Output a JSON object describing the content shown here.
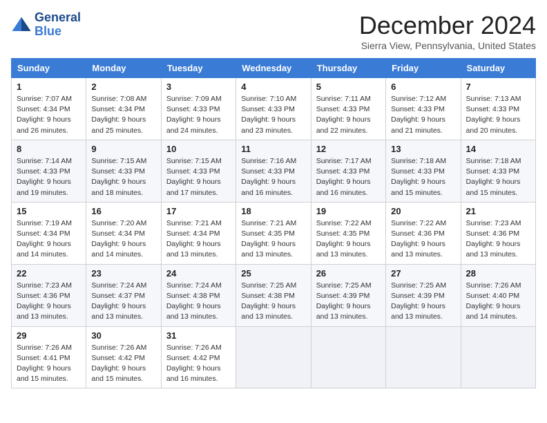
{
  "header": {
    "logo_line1": "General",
    "logo_line2": "Blue",
    "month_title": "December 2024",
    "location": "Sierra View, Pennsylvania, United States"
  },
  "days_of_week": [
    "Sunday",
    "Monday",
    "Tuesday",
    "Wednesday",
    "Thursday",
    "Friday",
    "Saturday"
  ],
  "weeks": [
    [
      {
        "day": "1",
        "sunrise": "Sunrise: 7:07 AM",
        "sunset": "Sunset: 4:34 PM",
        "daylight": "Daylight: 9 hours and 26 minutes."
      },
      {
        "day": "2",
        "sunrise": "Sunrise: 7:08 AM",
        "sunset": "Sunset: 4:34 PM",
        "daylight": "Daylight: 9 hours and 25 minutes."
      },
      {
        "day": "3",
        "sunrise": "Sunrise: 7:09 AM",
        "sunset": "Sunset: 4:33 PM",
        "daylight": "Daylight: 9 hours and 24 minutes."
      },
      {
        "day": "4",
        "sunrise": "Sunrise: 7:10 AM",
        "sunset": "Sunset: 4:33 PM",
        "daylight": "Daylight: 9 hours and 23 minutes."
      },
      {
        "day": "5",
        "sunrise": "Sunrise: 7:11 AM",
        "sunset": "Sunset: 4:33 PM",
        "daylight": "Daylight: 9 hours and 22 minutes."
      },
      {
        "day": "6",
        "sunrise": "Sunrise: 7:12 AM",
        "sunset": "Sunset: 4:33 PM",
        "daylight": "Daylight: 9 hours and 21 minutes."
      },
      {
        "day": "7",
        "sunrise": "Sunrise: 7:13 AM",
        "sunset": "Sunset: 4:33 PM",
        "daylight": "Daylight: 9 hours and 20 minutes."
      }
    ],
    [
      {
        "day": "8",
        "sunrise": "Sunrise: 7:14 AM",
        "sunset": "Sunset: 4:33 PM",
        "daylight": "Daylight: 9 hours and 19 minutes."
      },
      {
        "day": "9",
        "sunrise": "Sunrise: 7:15 AM",
        "sunset": "Sunset: 4:33 PM",
        "daylight": "Daylight: 9 hours and 18 minutes."
      },
      {
        "day": "10",
        "sunrise": "Sunrise: 7:15 AM",
        "sunset": "Sunset: 4:33 PM",
        "daylight": "Daylight: 9 hours and 17 minutes."
      },
      {
        "day": "11",
        "sunrise": "Sunrise: 7:16 AM",
        "sunset": "Sunset: 4:33 PM",
        "daylight": "Daylight: 9 hours and 16 minutes."
      },
      {
        "day": "12",
        "sunrise": "Sunrise: 7:17 AM",
        "sunset": "Sunset: 4:33 PM",
        "daylight": "Daylight: 9 hours and 16 minutes."
      },
      {
        "day": "13",
        "sunrise": "Sunrise: 7:18 AM",
        "sunset": "Sunset: 4:33 PM",
        "daylight": "Daylight: 9 hours and 15 minutes."
      },
      {
        "day": "14",
        "sunrise": "Sunrise: 7:18 AM",
        "sunset": "Sunset: 4:33 PM",
        "daylight": "Daylight: 9 hours and 15 minutes."
      }
    ],
    [
      {
        "day": "15",
        "sunrise": "Sunrise: 7:19 AM",
        "sunset": "Sunset: 4:34 PM",
        "daylight": "Daylight: 9 hours and 14 minutes."
      },
      {
        "day": "16",
        "sunrise": "Sunrise: 7:20 AM",
        "sunset": "Sunset: 4:34 PM",
        "daylight": "Daylight: 9 hours and 14 minutes."
      },
      {
        "day": "17",
        "sunrise": "Sunrise: 7:21 AM",
        "sunset": "Sunset: 4:34 PM",
        "daylight": "Daylight: 9 hours and 13 minutes."
      },
      {
        "day": "18",
        "sunrise": "Sunrise: 7:21 AM",
        "sunset": "Sunset: 4:35 PM",
        "daylight": "Daylight: 9 hours and 13 minutes."
      },
      {
        "day": "19",
        "sunrise": "Sunrise: 7:22 AM",
        "sunset": "Sunset: 4:35 PM",
        "daylight": "Daylight: 9 hours and 13 minutes."
      },
      {
        "day": "20",
        "sunrise": "Sunrise: 7:22 AM",
        "sunset": "Sunset: 4:36 PM",
        "daylight": "Daylight: 9 hours and 13 minutes."
      },
      {
        "day": "21",
        "sunrise": "Sunrise: 7:23 AM",
        "sunset": "Sunset: 4:36 PM",
        "daylight": "Daylight: 9 hours and 13 minutes."
      }
    ],
    [
      {
        "day": "22",
        "sunrise": "Sunrise: 7:23 AM",
        "sunset": "Sunset: 4:36 PM",
        "daylight": "Daylight: 9 hours and 13 minutes."
      },
      {
        "day": "23",
        "sunrise": "Sunrise: 7:24 AM",
        "sunset": "Sunset: 4:37 PM",
        "daylight": "Daylight: 9 hours and 13 minutes."
      },
      {
        "day": "24",
        "sunrise": "Sunrise: 7:24 AM",
        "sunset": "Sunset: 4:38 PM",
        "daylight": "Daylight: 9 hours and 13 minutes."
      },
      {
        "day": "25",
        "sunrise": "Sunrise: 7:25 AM",
        "sunset": "Sunset: 4:38 PM",
        "daylight": "Daylight: 9 hours and 13 minutes."
      },
      {
        "day": "26",
        "sunrise": "Sunrise: 7:25 AM",
        "sunset": "Sunset: 4:39 PM",
        "daylight": "Daylight: 9 hours and 13 minutes."
      },
      {
        "day": "27",
        "sunrise": "Sunrise: 7:25 AM",
        "sunset": "Sunset: 4:39 PM",
        "daylight": "Daylight: 9 hours and 13 minutes."
      },
      {
        "day": "28",
        "sunrise": "Sunrise: 7:26 AM",
        "sunset": "Sunset: 4:40 PM",
        "daylight": "Daylight: 9 hours and 14 minutes."
      }
    ],
    [
      {
        "day": "29",
        "sunrise": "Sunrise: 7:26 AM",
        "sunset": "Sunset: 4:41 PM",
        "daylight": "Daylight: 9 hours and 15 minutes."
      },
      {
        "day": "30",
        "sunrise": "Sunrise: 7:26 AM",
        "sunset": "Sunset: 4:42 PM",
        "daylight": "Daylight: 9 hours and 15 minutes."
      },
      {
        "day": "31",
        "sunrise": "Sunrise: 7:26 AM",
        "sunset": "Sunset: 4:42 PM",
        "daylight": "Daylight: 9 hours and 16 minutes."
      },
      null,
      null,
      null,
      null
    ]
  ]
}
